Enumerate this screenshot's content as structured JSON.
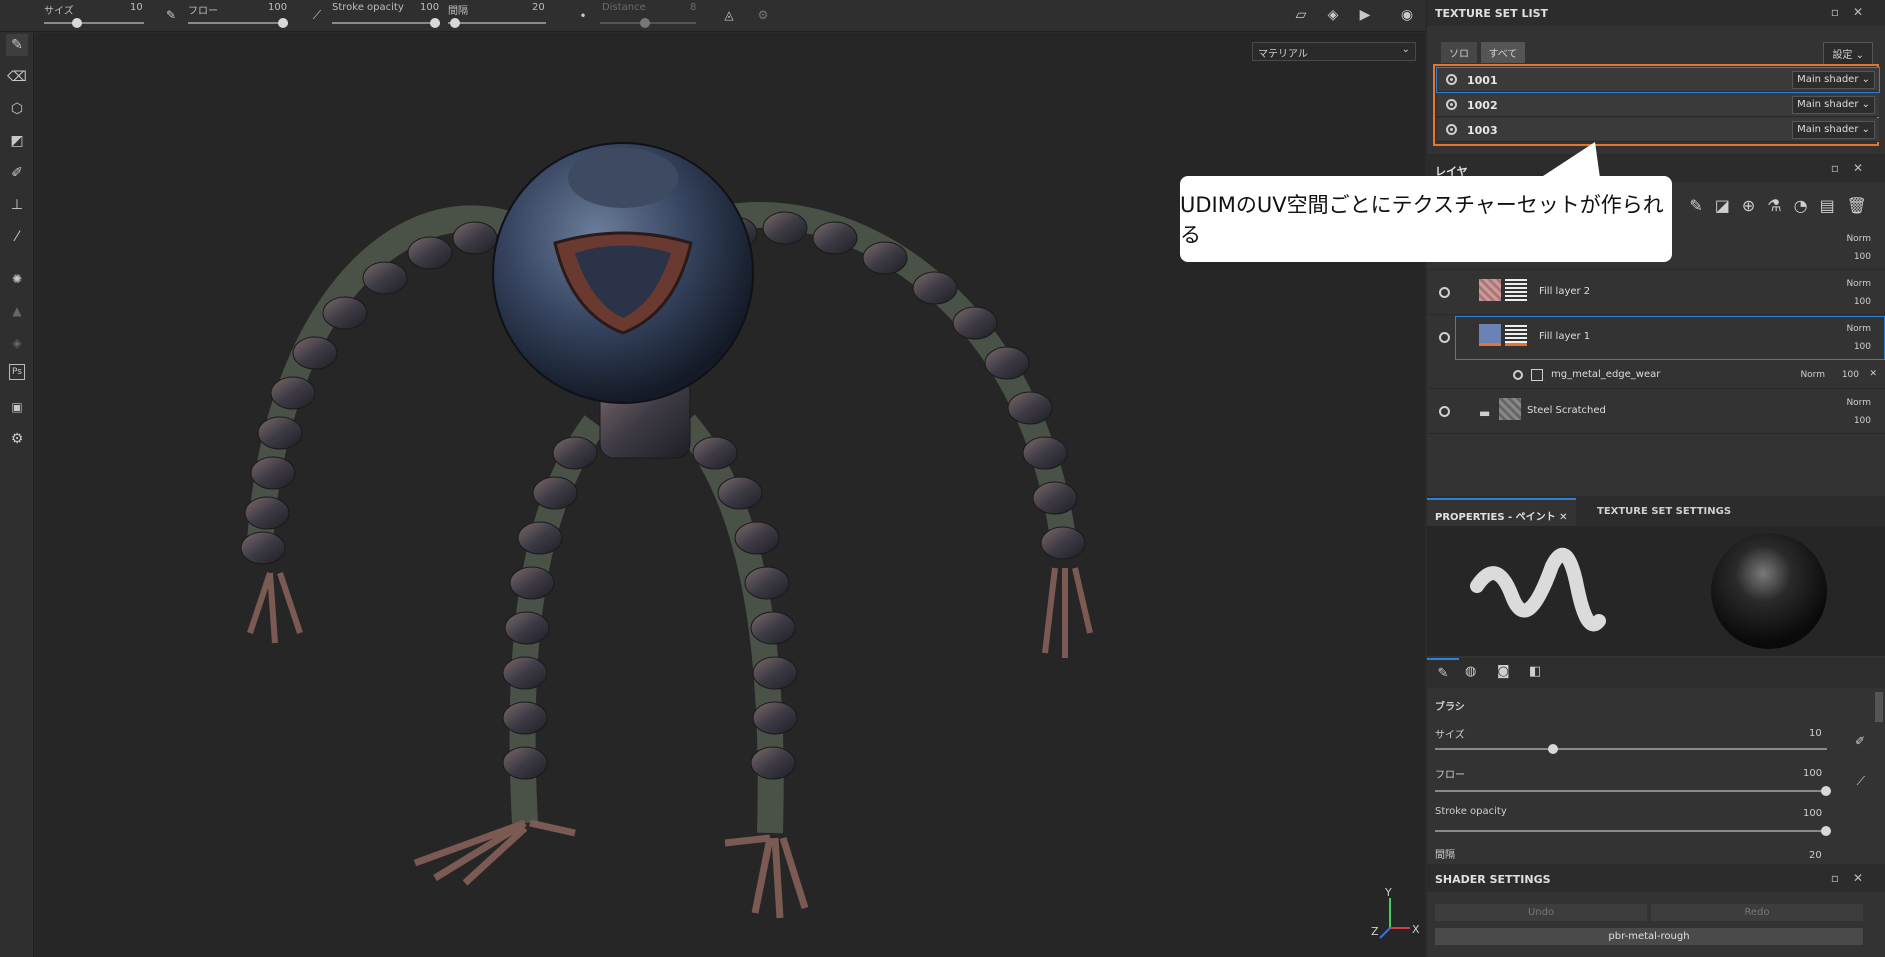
{
  "toolbar": {
    "size_label": "サイズ",
    "size_value": "10",
    "flow_label": "フロー",
    "flow_value": "100",
    "opacity_label": "Stroke opacity",
    "opacity_value": "100",
    "spacing_label": "間隔",
    "spacing_value": "20",
    "distance_label": "Distance",
    "distance_value": "8"
  },
  "viewport": {
    "material_mode": "マテリアル",
    "axis_y": "Y",
    "axis_x": "X",
    "axis_z": "Z"
  },
  "texture_set_list": {
    "title": "TEXTURE SET LIST",
    "solo_label": "ソロ",
    "all_label": "すべて",
    "settings_label": "設定",
    "sets": [
      {
        "name": "1001",
        "shader": "Main shader"
      },
      {
        "name": "1002",
        "shader": "Main shader"
      },
      {
        "name": "1003",
        "shader": "Main shader"
      }
    ]
  },
  "callout": {
    "text": "UDIMのUV空間ごとにテクスチャーセットが作られる"
  },
  "layers": {
    "title": "レイヤ",
    "items": [
      {
        "name": "",
        "blend": "Norm",
        "opacity": "100"
      },
      {
        "name": "Fill layer 2",
        "blend": "Norm",
        "opacity": "100"
      },
      {
        "name": "Fill layer 1",
        "blend": "Norm",
        "opacity": "100"
      },
      {
        "name": "mg_metal_edge_wear",
        "blend": "Norm",
        "opacity": "100"
      },
      {
        "name": "Steel Scratched",
        "blend": "Norm",
        "opacity": "100"
      }
    ]
  },
  "properties": {
    "tab_paint": "PROPERTIES - ペイント",
    "tab_texture": "TEXTURE SET SETTINGS",
    "brush_section": "ブラシ",
    "size_label": "サイズ",
    "size_value": "10",
    "size_fraction": 0.1,
    "flow_label": "フロー",
    "flow_value": "100",
    "opacity_label": "Stroke opacity",
    "opacity_value": "100",
    "spacing_label": "間隔",
    "spacing_value": "20"
  },
  "shader_settings": {
    "title": "SHADER SETTINGS",
    "undo_label": "Undo",
    "redo_label": "Redo",
    "shader_name": "pbr-metal-rough"
  },
  "colors": {
    "accent_orange": "#e3762a",
    "selection_blue": "#2e7fd6"
  }
}
